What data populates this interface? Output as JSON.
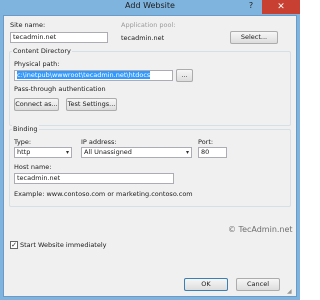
{
  "window": {
    "title": "Add Website",
    "help_label": "?",
    "close_label": "✕"
  },
  "site": {
    "site_name_label": "Site name:",
    "site_name_value": "tecadmin.net",
    "app_pool_label": "Application pool:",
    "app_pool_value": "tecadmin.net",
    "select_button": "Select..."
  },
  "content_directory": {
    "group_label": "Content Directory",
    "physical_path_label": "Physical path:",
    "physical_path_value": "c:\\inetpub\\wwwroot\\tecadmin.net\\htdocs",
    "browse_button": "...",
    "passthrough_label": "Pass-through authentication",
    "connect_as_button": "Connect as...",
    "test_settings_button": "Test Settings..."
  },
  "binding": {
    "group_label": "Binding",
    "type_label": "Type:",
    "type_value": "http",
    "ip_label": "IP address:",
    "ip_value": "All Unassigned",
    "port_label": "Port:",
    "port_value": "80",
    "host_name_label": "Host name:",
    "host_name_value": "tecadmin.net",
    "example_text": "Example: www.contoso.com or marketing.contoso.com"
  },
  "options": {
    "start_immediately_label": "Start Website immediately",
    "start_immediately_checked": true
  },
  "footer": {
    "ok_button": "OK",
    "cancel_button": "Cancel"
  },
  "watermark": "© TecAdmin.net",
  "colors": {
    "title_bar": "#7fb4de",
    "close_button": "#c84031",
    "selection": "#3399ff",
    "dialog_bg": "#f0f0f0"
  }
}
